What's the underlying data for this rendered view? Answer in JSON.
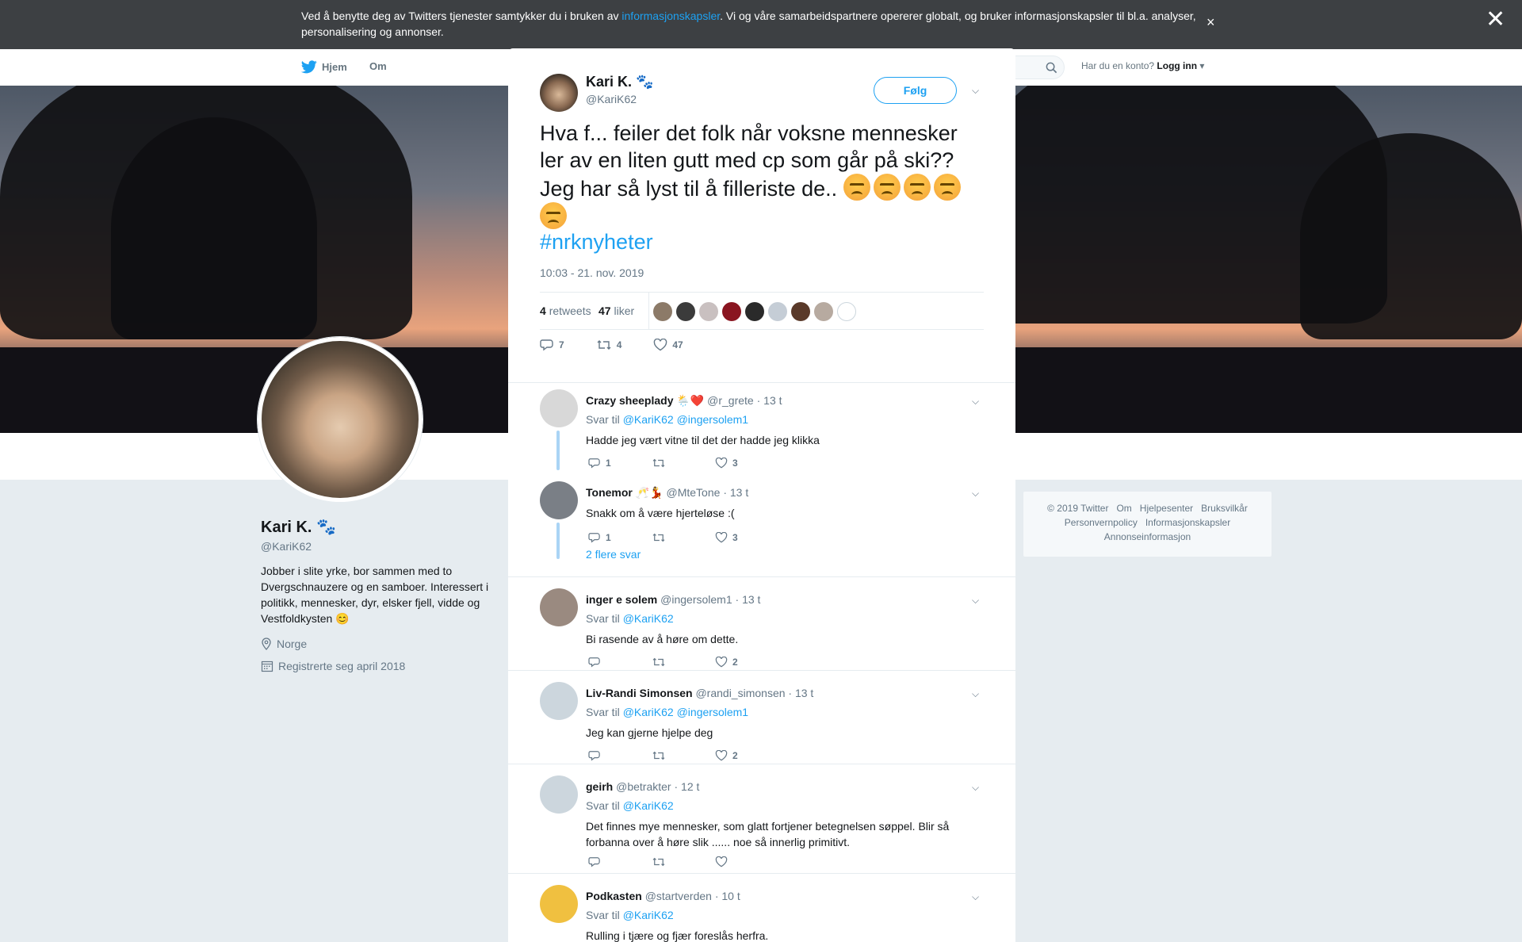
{
  "cookie": {
    "text_before": "Ved å benytte deg av Twitters tjenester samtykker du i bruken av ",
    "link": "informasjonskapsler",
    "text_after": ". Vi og våre samarbeidspartnere opererer globalt, og bruker informasjonskapsler til bl.a. analyser, personalisering og annonser.",
    "close": "×"
  },
  "overlay_close": "✕",
  "nav": {
    "home": "Hjem",
    "about": "Om",
    "account_prompt": "Har du en konto?",
    "login": "Logg inn"
  },
  "profile": {
    "name": "Kari K. 🐾",
    "handle": "@KariK62",
    "bio": "Jobber i slite yrke, bor sammen med to Dvergschnauzere og en samboer. Interessert i politikk, mennesker, dyr, elsker fjell, vidde og Vestfoldkysten 😊",
    "location": "Norge",
    "registered": "Registrerte seg april 2018"
  },
  "footer": {
    "links": [
      "© 2019 Twitter",
      "Om",
      "Hjelpesenter",
      "Bruksvilkår",
      "Personvernpolicy",
      "Informasjonskapsler",
      "Annonseinformasjon"
    ]
  },
  "tweet": {
    "name": "Kari K. 🐾",
    "handle": "@KariK62",
    "follow": "Følg",
    "text": "Hva f... feiler det folk når voksne mennesker ler av en liten gutt med cp som går på ski?? Jeg har så lyst til å filleriste de..",
    "hashtag": "#nrknyheter",
    "time": "10:03 - 21. nov. 2019",
    "retweets_count": "4",
    "retweets_label": "retweets",
    "likes_count": "47",
    "likes_label": "liker",
    "actions": {
      "replies": "7",
      "retweets": "4",
      "likes": "47"
    },
    "liker_colors": [
      "#8c7a68",
      "#3b3b3b",
      "#c9c0c0",
      "#8a1520",
      "#2a2a2a",
      "#c5cdd6",
      "#5a3a2a",
      "#b7aaa0",
      "#ffffff"
    ]
  },
  "replies": [
    {
      "name": "Crazy sheeplady 🌦️❤️",
      "handle": "@r_grete",
      "time": "· 13 t",
      "reply_to_label": "Svar til",
      "reply_to": "@KariK62 @ingersolem1",
      "text": "Hadde jeg vært vitne til det der hadde jeg klikka",
      "replies": "1",
      "retweets": "",
      "likes": "3",
      "avatar": "#d8d8d8"
    },
    {
      "name": "Tonemor 🥂💃",
      "handle": "@MteTone",
      "time": "· 13 t",
      "text": "Snakk om å være hjerteløse  :(",
      "replies": "1",
      "retweets": "",
      "likes": "3",
      "avatar": "#7a7f86",
      "more": "2 flere svar"
    },
    {
      "name": "inger e solem",
      "handle": "@ingersolem1",
      "time": "· 13 t",
      "reply_to_label": "Svar til",
      "reply_to": "@KariK62",
      "text": "Bi rasende av å høre om dette.",
      "replies": "",
      "retweets": "",
      "likes": "2",
      "avatar": "#9a8a80"
    },
    {
      "name": "Liv-Randi Simonsen",
      "handle": "@randi_simonsen",
      "time": "· 13 t",
      "reply_to_label": "Svar til",
      "reply_to": "@KariK62 @ingersolem1",
      "text": "Jeg kan gjerne hjelpe deg",
      "replies": "",
      "retweets": "",
      "likes": "2",
      "avatar": "#ccd6dd"
    },
    {
      "name": "geirh",
      "handle": "@betrakter",
      "time": "· 12 t",
      "reply_to_label": "Svar til",
      "reply_to": "@KariK62",
      "text": "Det finnes mye mennesker, som glatt fortjener betegnelsen søppel. Blir så forbanna over å høre slik ...... noe så innerlig primitivt.",
      "replies": "",
      "retweets": "",
      "likes": "",
      "avatar": "#ccd6dd"
    },
    {
      "name": "Podkasten",
      "handle": "@startverden",
      "time": "· 10 t",
      "reply_to_label": "Svar til",
      "reply_to": "@KariK62",
      "text": "Rulling i tjære og fjær foreslås herfra.",
      "avatar": "#f0c040"
    }
  ]
}
